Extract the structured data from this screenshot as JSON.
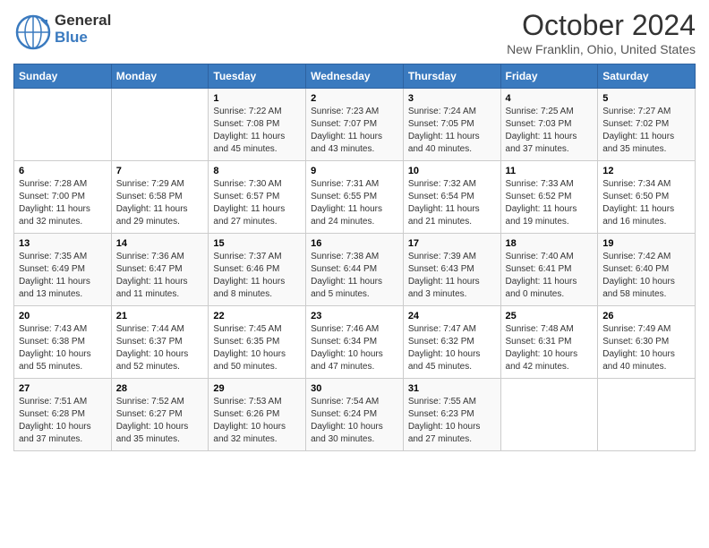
{
  "logo": {
    "general": "General",
    "blue": "Blue"
  },
  "title": "October 2024",
  "location": "New Franklin, Ohio, United States",
  "days_of_week": [
    "Sunday",
    "Monday",
    "Tuesday",
    "Wednesday",
    "Thursday",
    "Friday",
    "Saturday"
  ],
  "weeks": [
    [
      {
        "num": "",
        "sunrise": "",
        "sunset": "",
        "daylight": ""
      },
      {
        "num": "",
        "sunrise": "",
        "sunset": "",
        "daylight": ""
      },
      {
        "num": "1",
        "sunrise": "Sunrise: 7:22 AM",
        "sunset": "Sunset: 7:08 PM",
        "daylight": "Daylight: 11 hours and 45 minutes."
      },
      {
        "num": "2",
        "sunrise": "Sunrise: 7:23 AM",
        "sunset": "Sunset: 7:07 PM",
        "daylight": "Daylight: 11 hours and 43 minutes."
      },
      {
        "num": "3",
        "sunrise": "Sunrise: 7:24 AM",
        "sunset": "Sunset: 7:05 PM",
        "daylight": "Daylight: 11 hours and 40 minutes."
      },
      {
        "num": "4",
        "sunrise": "Sunrise: 7:25 AM",
        "sunset": "Sunset: 7:03 PM",
        "daylight": "Daylight: 11 hours and 37 minutes."
      },
      {
        "num": "5",
        "sunrise": "Sunrise: 7:27 AM",
        "sunset": "Sunset: 7:02 PM",
        "daylight": "Daylight: 11 hours and 35 minutes."
      }
    ],
    [
      {
        "num": "6",
        "sunrise": "Sunrise: 7:28 AM",
        "sunset": "Sunset: 7:00 PM",
        "daylight": "Daylight: 11 hours and 32 minutes."
      },
      {
        "num": "7",
        "sunrise": "Sunrise: 7:29 AM",
        "sunset": "Sunset: 6:58 PM",
        "daylight": "Daylight: 11 hours and 29 minutes."
      },
      {
        "num": "8",
        "sunrise": "Sunrise: 7:30 AM",
        "sunset": "Sunset: 6:57 PM",
        "daylight": "Daylight: 11 hours and 27 minutes."
      },
      {
        "num": "9",
        "sunrise": "Sunrise: 7:31 AM",
        "sunset": "Sunset: 6:55 PM",
        "daylight": "Daylight: 11 hours and 24 minutes."
      },
      {
        "num": "10",
        "sunrise": "Sunrise: 7:32 AM",
        "sunset": "Sunset: 6:54 PM",
        "daylight": "Daylight: 11 hours and 21 minutes."
      },
      {
        "num": "11",
        "sunrise": "Sunrise: 7:33 AM",
        "sunset": "Sunset: 6:52 PM",
        "daylight": "Daylight: 11 hours and 19 minutes."
      },
      {
        "num": "12",
        "sunrise": "Sunrise: 7:34 AM",
        "sunset": "Sunset: 6:50 PM",
        "daylight": "Daylight: 11 hours and 16 minutes."
      }
    ],
    [
      {
        "num": "13",
        "sunrise": "Sunrise: 7:35 AM",
        "sunset": "Sunset: 6:49 PM",
        "daylight": "Daylight: 11 hours and 13 minutes."
      },
      {
        "num": "14",
        "sunrise": "Sunrise: 7:36 AM",
        "sunset": "Sunset: 6:47 PM",
        "daylight": "Daylight: 11 hours and 11 minutes."
      },
      {
        "num": "15",
        "sunrise": "Sunrise: 7:37 AM",
        "sunset": "Sunset: 6:46 PM",
        "daylight": "Daylight: 11 hours and 8 minutes."
      },
      {
        "num": "16",
        "sunrise": "Sunrise: 7:38 AM",
        "sunset": "Sunset: 6:44 PM",
        "daylight": "Daylight: 11 hours and 5 minutes."
      },
      {
        "num": "17",
        "sunrise": "Sunrise: 7:39 AM",
        "sunset": "Sunset: 6:43 PM",
        "daylight": "Daylight: 11 hours and 3 minutes."
      },
      {
        "num": "18",
        "sunrise": "Sunrise: 7:40 AM",
        "sunset": "Sunset: 6:41 PM",
        "daylight": "Daylight: 11 hours and 0 minutes."
      },
      {
        "num": "19",
        "sunrise": "Sunrise: 7:42 AM",
        "sunset": "Sunset: 6:40 PM",
        "daylight": "Daylight: 10 hours and 58 minutes."
      }
    ],
    [
      {
        "num": "20",
        "sunrise": "Sunrise: 7:43 AM",
        "sunset": "Sunset: 6:38 PM",
        "daylight": "Daylight: 10 hours and 55 minutes."
      },
      {
        "num": "21",
        "sunrise": "Sunrise: 7:44 AM",
        "sunset": "Sunset: 6:37 PM",
        "daylight": "Daylight: 10 hours and 52 minutes."
      },
      {
        "num": "22",
        "sunrise": "Sunrise: 7:45 AM",
        "sunset": "Sunset: 6:35 PM",
        "daylight": "Daylight: 10 hours and 50 minutes."
      },
      {
        "num": "23",
        "sunrise": "Sunrise: 7:46 AM",
        "sunset": "Sunset: 6:34 PM",
        "daylight": "Daylight: 10 hours and 47 minutes."
      },
      {
        "num": "24",
        "sunrise": "Sunrise: 7:47 AM",
        "sunset": "Sunset: 6:32 PM",
        "daylight": "Daylight: 10 hours and 45 minutes."
      },
      {
        "num": "25",
        "sunrise": "Sunrise: 7:48 AM",
        "sunset": "Sunset: 6:31 PM",
        "daylight": "Daylight: 10 hours and 42 minutes."
      },
      {
        "num": "26",
        "sunrise": "Sunrise: 7:49 AM",
        "sunset": "Sunset: 6:30 PM",
        "daylight": "Daylight: 10 hours and 40 minutes."
      }
    ],
    [
      {
        "num": "27",
        "sunrise": "Sunrise: 7:51 AM",
        "sunset": "Sunset: 6:28 PM",
        "daylight": "Daylight: 10 hours and 37 minutes."
      },
      {
        "num": "28",
        "sunrise": "Sunrise: 7:52 AM",
        "sunset": "Sunset: 6:27 PM",
        "daylight": "Daylight: 10 hours and 35 minutes."
      },
      {
        "num": "29",
        "sunrise": "Sunrise: 7:53 AM",
        "sunset": "Sunset: 6:26 PM",
        "daylight": "Daylight: 10 hours and 32 minutes."
      },
      {
        "num": "30",
        "sunrise": "Sunrise: 7:54 AM",
        "sunset": "Sunset: 6:24 PM",
        "daylight": "Daylight: 10 hours and 30 minutes."
      },
      {
        "num": "31",
        "sunrise": "Sunrise: 7:55 AM",
        "sunset": "Sunset: 6:23 PM",
        "daylight": "Daylight: 10 hours and 27 minutes."
      },
      {
        "num": "",
        "sunrise": "",
        "sunset": "",
        "daylight": ""
      },
      {
        "num": "",
        "sunrise": "",
        "sunset": "",
        "daylight": ""
      }
    ]
  ]
}
